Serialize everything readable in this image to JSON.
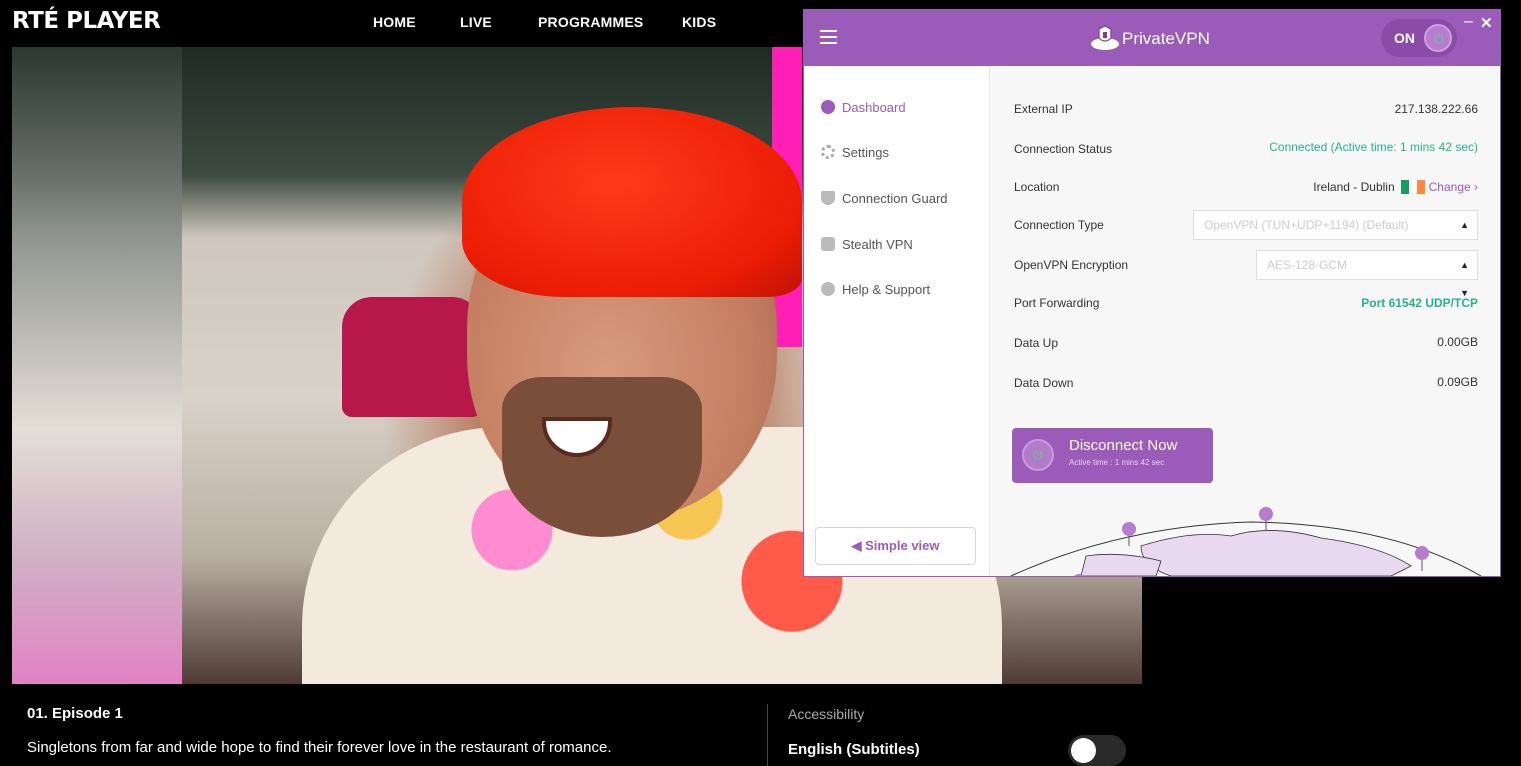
{
  "rte": {
    "logo_prefix": "RTÉ",
    "logo_suffix": "PLAYER",
    "nav": [
      "HOME",
      "LIVE",
      "PROGRAMMES",
      "KIDS"
    ]
  },
  "episode": {
    "title": "01. Episode 1",
    "description": "Singletons from far and wide hope to find their forever love in the restaurant of romance."
  },
  "accessibility": {
    "label": "Accessibility",
    "subtitle_option": "English (Subtitles)",
    "subtitles_on": false
  },
  "vpn": {
    "brand": "PrivateVPN",
    "status_toggle": "ON",
    "window_min": "–",
    "window_close": "✕",
    "sidebar": [
      {
        "label": "Dashboard",
        "icon": "dashboard-icon",
        "active": true
      },
      {
        "label": "Settings",
        "icon": "gear-icon",
        "active": false
      },
      {
        "label": "Connection Guard",
        "icon": "shield-icon",
        "active": false
      },
      {
        "label": "Stealth VPN",
        "icon": "lock-icon",
        "active": false
      },
      {
        "label": "Help & Support",
        "icon": "help-icon",
        "active": false
      }
    ],
    "simple_view": "Simple view",
    "dashboard": {
      "external_ip_label": "External IP",
      "external_ip": "217.138.222.66",
      "connection_status_label": "Connection Status",
      "connection_status": "Connected  (Active time:  1 mins 42 sec)",
      "location_label": "Location",
      "location": "Ireland - Dublin",
      "change_link": "Change ›",
      "connection_type_label": "Connection Type",
      "connection_type": "OpenVPN (TUN+UDP+1194) (Default)",
      "encryption_label": "OpenVPN Encryption",
      "encryption": "AES-128-GCM",
      "port_forwarding_label": "Port Forwarding",
      "port_forwarding": "Port 61542 UDP/TCP",
      "data_up_label": "Data Up",
      "data_up": "0.00GB",
      "data_down_label": "Data Down",
      "data_down": "0.09GB",
      "disconnect_label": "Disconnect Now",
      "disconnect_sub": "Active time :  1 mins 42 sec",
      "accent_color": "#9b5bb8",
      "connected_color": "#27b38a"
    }
  }
}
